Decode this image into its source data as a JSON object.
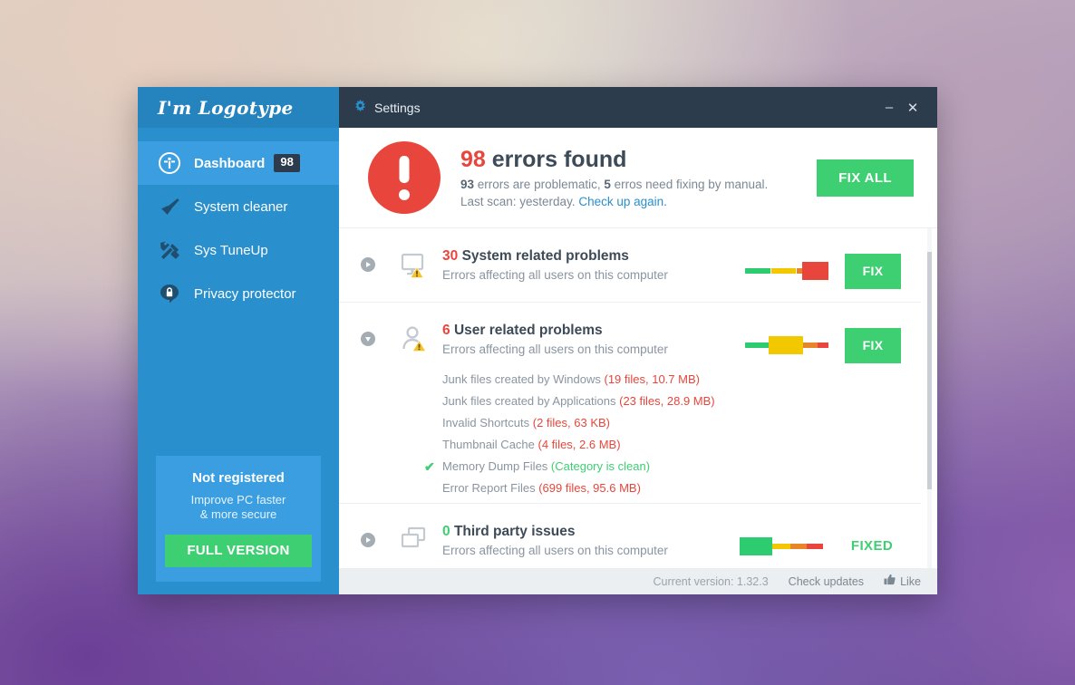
{
  "sidebar": {
    "logo": "I'm Logotype",
    "items": [
      {
        "label": "Dashboard",
        "icon": "info-circle-icon",
        "badge": "98",
        "active": true
      },
      {
        "label": "System cleaner",
        "icon": "brush-icon",
        "badge": "",
        "active": false
      },
      {
        "label": "Sys TuneUp",
        "icon": "tools-icon",
        "badge": "",
        "active": false
      },
      {
        "label": "Privacy protector",
        "icon": "lock-icon",
        "badge": "",
        "active": false
      }
    ],
    "promo": {
      "title": "Not registered",
      "line1": "Improve PC faster",
      "line2": "& more secure",
      "button": "FULL VERSION"
    }
  },
  "titlebar": {
    "icon": "gear-icon",
    "title": "Settings",
    "minimize": "–",
    "close": "✕"
  },
  "summary": {
    "icon": "alert-exclamation-icon",
    "count": "98",
    "title_rest": "errors found",
    "problematic_count": "93",
    "problematic_text": "errors are problematic,",
    "manual_count": "5",
    "manual_text": "erros need fixing by manual.",
    "last_scan": "Last scan: yesterday.",
    "recheck_link": "Check up again.",
    "fix_all_button": "FIX ALL"
  },
  "problems": [
    {
      "count": "30",
      "count_color": "red",
      "title": "System related problems",
      "subtitle": "Errors affecting all users on this computer",
      "icon": "monitor-warning-icon",
      "expanded": false,
      "action": "FIX",
      "action_kind": "button",
      "meter": {
        "big_index": 3,
        "segments": [
          "#2ecc71",
          "#f2c800",
          "#e8852a",
          "#e8463c"
        ]
      },
      "details": []
    },
    {
      "count": "6",
      "count_color": "red",
      "title": "User related problems",
      "subtitle": "Errors affecting all users on this computer",
      "icon": "user-warning-icon",
      "expanded": true,
      "action": "FIX",
      "action_kind": "button",
      "meter": {
        "big_index": 1,
        "segments": [
          "#2ecc71",
          "#f2c800",
          "#e8852a",
          "#e8463c"
        ]
      },
      "details": [
        {
          "label": "Junk files created by Windows",
          "value": "(19 files, 10.7 MB)",
          "clean": false
        },
        {
          "label": "Junk files created by Applications",
          "value": "(23 files, 28.9 MB)",
          "clean": false
        },
        {
          "label": "Invalid Shortcuts",
          "value": "(2 files, 63 KB)",
          "clean": false
        },
        {
          "label": "Thumbnail Cache",
          "value": "(4 files, 2.6 MB)",
          "clean": false
        },
        {
          "label": "Memory Dump Files",
          "value": "(Category is clean)",
          "clean": true
        },
        {
          "label": "Error Report Files",
          "value": "(699 files, 95.6 MB)",
          "clean": false
        }
      ]
    },
    {
      "count": "0",
      "count_color": "green",
      "title": "Third party issues",
      "subtitle": "Errors affecting all users on this computer",
      "icon": "windows-stack-icon",
      "expanded": false,
      "action": "FIXED",
      "action_kind": "text",
      "meter": {
        "big_index": 0,
        "segments": [
          "#2ecc71",
          "#f2c800",
          "#e8852a",
          "#e8463c"
        ]
      },
      "details": []
    }
  ],
  "statusbar": {
    "version": "Current version: 1.32.3",
    "check_updates": "Check updates",
    "like": "Like",
    "like_icon": "thumbs-up-icon"
  },
  "colors": {
    "accent_blue": "#2a8fcd",
    "active_blue": "#3a9ee0",
    "titlebar_dark": "#2d3c4c",
    "green": "#3ecf72",
    "red": "#e8463c",
    "yellow": "#f2c800",
    "orange": "#e8852a"
  }
}
